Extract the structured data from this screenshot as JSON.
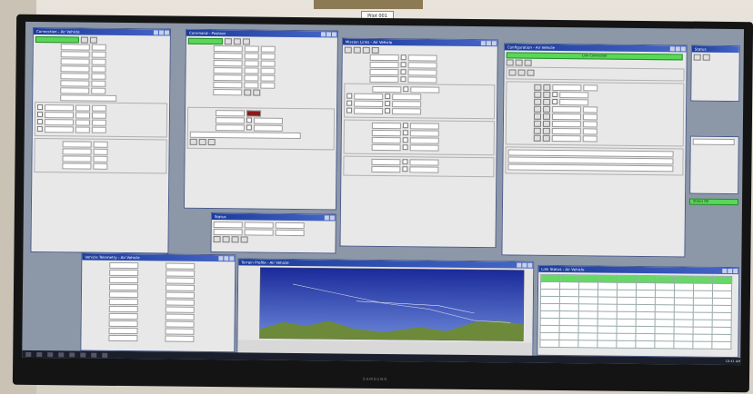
{
  "room": {
    "label_tag": "Pilot 001"
  },
  "monitor": {
    "brand": "SAMSUNG"
  },
  "windows": {
    "w1": {
      "title": "Connection - Air Vehicle"
    },
    "w2": {
      "title": "Command - Position"
    },
    "w3": {
      "title": "Mission Links - Air Vehicle"
    },
    "w4": {
      "title": "Configuration - Air Vehicle"
    },
    "w5": {
      "title": "Vehicle Telemetry - Air Vehicle"
    },
    "w6": {
      "title": "Terrain Profile - Air Vehicle"
    },
    "w7": {
      "title": "Link Status - Air Vehicle"
    },
    "w8": {
      "title": "Waypoint Editor - Air Vehicle"
    },
    "w9": {
      "title": "Status"
    }
  },
  "config": {
    "green_bar": "Link Connected"
  },
  "status_side": {
    "green_label": "Status OK"
  },
  "taskbar": {
    "clock": "10:41 AM"
  }
}
